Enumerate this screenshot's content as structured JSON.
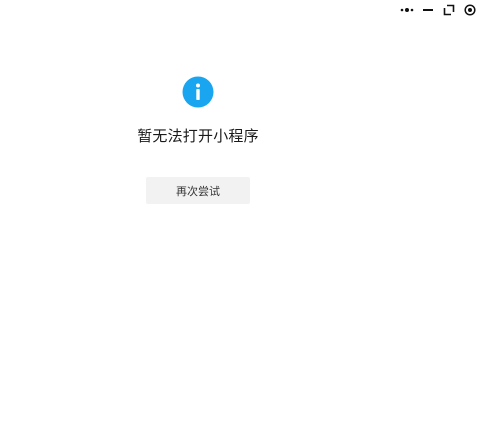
{
  "window_controls": {
    "items": [
      {
        "icon": "more-icon"
      },
      {
        "icon": "minimize-icon"
      },
      {
        "icon": "restore-icon"
      },
      {
        "icon": "close-target-icon"
      }
    ]
  },
  "error": {
    "icon": "info-icon",
    "icon_color": "#1aa5f0",
    "message": "暂无法打开小程序",
    "retry_label": "再次尝试"
  }
}
